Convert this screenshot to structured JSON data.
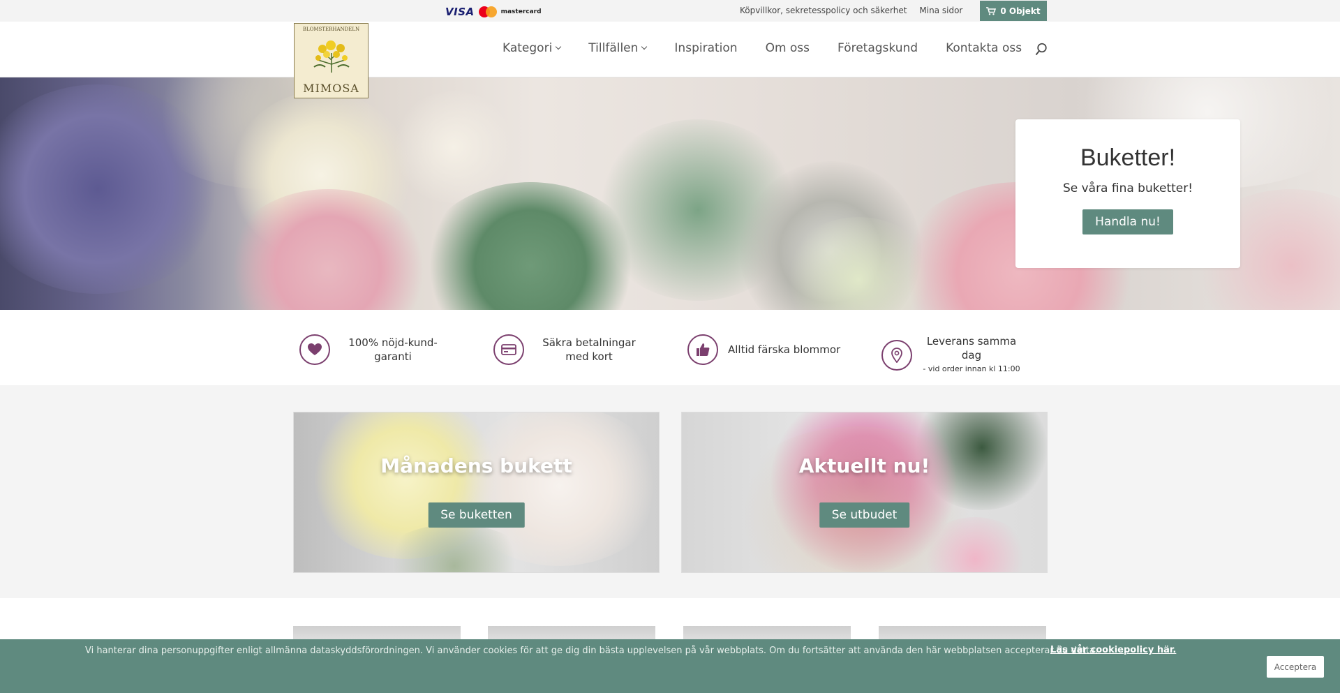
{
  "topbar": {
    "visa_label": "VISA",
    "mastercard_label": "mastercard",
    "links": [
      "Köpvillkor, sekretesspolicy och säkerhet",
      "Mina sidor"
    ],
    "cart_label": "0 Objekt"
  },
  "logo": {
    "top_text": "BLOMSTERHANDELN",
    "name": "MIMOSA"
  },
  "nav": {
    "items": [
      {
        "label": "Kategori",
        "dropdown": true
      },
      {
        "label": "Tillfällen",
        "dropdown": true
      },
      {
        "label": "Inspiration",
        "dropdown": false
      },
      {
        "label": "Om oss",
        "dropdown": false
      },
      {
        "label": "Företagskund",
        "dropdown": false
      },
      {
        "label": "Kontakta oss",
        "dropdown": false
      }
    ],
    "search_icon": "search-icon"
  },
  "hero": {
    "title": "Buketter!",
    "subtitle": "Se våra fina buketter!",
    "button": "Handla nu!"
  },
  "features": [
    {
      "icon": "heart-icon",
      "text": "100% nöjd-kund-garanti",
      "sub": ""
    },
    {
      "icon": "credit-card-icon",
      "text": "Säkra betalningar med kort",
      "sub": ""
    },
    {
      "icon": "thumbs-up-icon",
      "text": "Alltid färska blommor",
      "sub": ""
    },
    {
      "icon": "location-pin-icon",
      "text": "Leverans samma dag",
      "sub": "- vid order innan kl 11:00"
    }
  ],
  "promos": [
    {
      "title": "Månadens bukett",
      "button": "Se buketten"
    },
    {
      "title": "Aktuellt nu!",
      "button": "Se utbudet"
    }
  ],
  "cookie": {
    "text": "Vi hanterar dina personuppgifter enligt allmänna dataskyddsförordningen. Vi använder cookies för att ge dig din bästa upplevelsen på vår webbplats. Om du fortsätter att använda den här webbplatsen accepterar du detta.",
    "link": "Läs vår cookiepolicy här.",
    "accept": "Acceptera"
  },
  "colors": {
    "accent": "#5f8a7f",
    "icon_purple": "#7b3f6e"
  }
}
